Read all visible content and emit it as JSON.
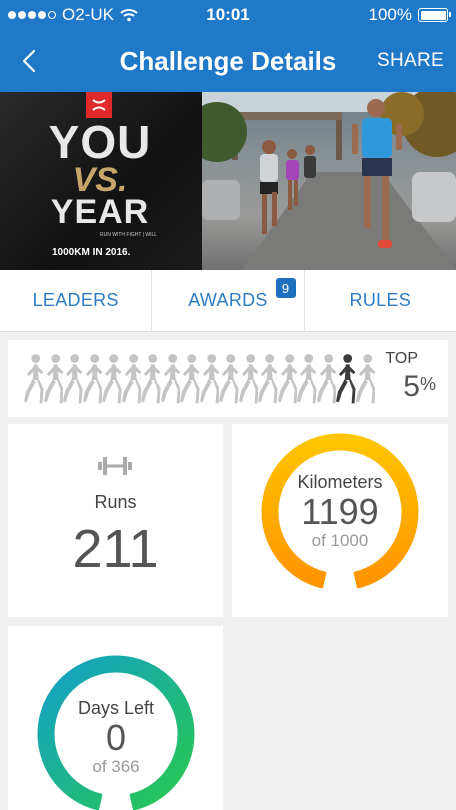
{
  "status": {
    "carrier": "O2-UK",
    "time": "10:01",
    "battery": "100%"
  },
  "nav": {
    "title": "Challenge Details",
    "share_label": "SHARE"
  },
  "banner": {
    "line1": "YOU",
    "line2": "VS.",
    "line3": "YEAR",
    "tagline": "RUN WITH FIGHT | WILL",
    "goal_text": "1000KM IN 2016."
  },
  "tabs": [
    {
      "label": "LEADERS"
    },
    {
      "label": "AWARDS",
      "badge": "9"
    },
    {
      "label": "RULES"
    }
  ],
  "rank": {
    "top_label": "TOP",
    "top_value": "5",
    "top_unit": "%",
    "runner_count": 18,
    "highlight_index": 16
  },
  "stats": {
    "runs": {
      "label": "Runs",
      "value": "211",
      "icon": "dumbbell-icon"
    },
    "kilometers": {
      "label": "Kilometers",
      "value": "1199",
      "target": "of 1000",
      "progress": 1.0
    },
    "days_left": {
      "label": "Days Left",
      "value": "0",
      "target": "of 366",
      "progress": 1.0
    }
  },
  "colors": {
    "brand_blue": "#1f78c8",
    "tab_text": "#2e7dc4",
    "km_ring_start": "#ffc400",
    "km_ring_end": "#ff9500",
    "days_ring_start": "#14a0c8",
    "days_ring_end": "#28c850"
  }
}
